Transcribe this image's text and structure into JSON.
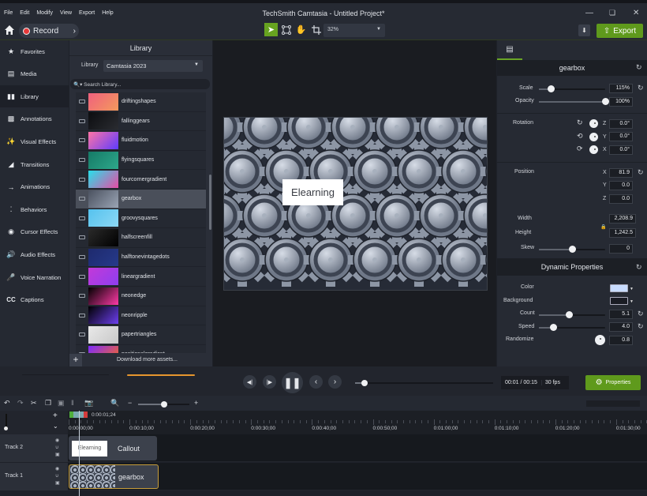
{
  "window": {
    "title": "TechSmith Camtasia - Untitled Project*",
    "menu": [
      "File",
      "Edit",
      "Modify",
      "View",
      "Export",
      "Help"
    ]
  },
  "toolbar": {
    "record_label": "Record",
    "zoom_value": "32%",
    "export_label": "Export",
    "accent_color": "#67a320"
  },
  "nav": {
    "items": [
      {
        "label": "Favorites",
        "icon": "star-icon"
      },
      {
        "label": "Media",
        "icon": "film-icon"
      },
      {
        "label": "Library",
        "icon": "library-icon",
        "active": true
      },
      {
        "label": "Annotations",
        "icon": "annotation-icon"
      },
      {
        "label": "Visual Effects",
        "icon": "wand-icon"
      },
      {
        "label": "Transitions",
        "icon": "transition-icon"
      },
      {
        "label": "Animations",
        "icon": "animation-icon"
      },
      {
        "label": "Behaviors",
        "icon": "behaviors-icon"
      },
      {
        "label": "Cursor Effects",
        "icon": "cursor-icon"
      },
      {
        "label": "Audio Effects",
        "icon": "speaker-icon"
      },
      {
        "label": "Voice Narration",
        "icon": "microphone-icon"
      },
      {
        "label": "Captions",
        "icon": "cc-icon"
      }
    ]
  },
  "library": {
    "title": "Library",
    "selector_label": "Library",
    "selector_value": "Camtasia 2023",
    "search_placeholder": "Search Library...",
    "items": [
      {
        "name": "driftingshapes",
        "colors": [
          "#f0607e",
          "#f49a5c"
        ]
      },
      {
        "name": "fallinggears",
        "colors": [
          "#0c0d10",
          "#2a2c31"
        ]
      },
      {
        "name": "fluidmotion",
        "colors": [
          "#ff74a6",
          "#5e3bff"
        ]
      },
      {
        "name": "flyingsquares",
        "colors": [
          "#157a66",
          "#2ea88b"
        ]
      },
      {
        "name": "fourcornergradient",
        "colors": [
          "#27e0ea",
          "#e84ca5"
        ]
      },
      {
        "name": "gearbox",
        "colors": [
          "#4b5260",
          "#9aa4b4"
        ],
        "selected": true
      },
      {
        "name": "groovysquares",
        "colors": [
          "#55c2ee",
          "#8dd8f5"
        ]
      },
      {
        "name": "halfscreenfill",
        "colors": [
          "#2a2a2a",
          "#000000"
        ]
      },
      {
        "name": "halftonevintagedots",
        "colors": [
          "#1e2a6e",
          "#263a8a"
        ]
      },
      {
        "name": "lineargradient",
        "colors": [
          "#c339d8",
          "#8d3ff0"
        ]
      },
      {
        "name": "neonedge",
        "colors": [
          "#000000",
          "#ff3aa6"
        ]
      },
      {
        "name": "neonripple",
        "colors": [
          "#000000",
          "#6d3ff0"
        ]
      },
      {
        "name": "papertriangles",
        "colors": [
          "#e9e9e9",
          "#c8c8c8"
        ]
      },
      {
        "name": "positionalgradient",
        "colors": [
          "#7d2bff",
          "#ff6a1a"
        ]
      }
    ],
    "download_label": "Download more assets..."
  },
  "canvas": {
    "callout_text": "Elearning"
  },
  "properties": {
    "title": "gearbox",
    "scale": {
      "label": "Scale",
      "value": "115%",
      "fraction": 0.18
    },
    "opacity": {
      "label": "Opacity",
      "value": "100%",
      "fraction": 1.0
    },
    "rotation": {
      "label": "Rotation",
      "z": "0.0°",
      "y": "0.0°",
      "x": "0.0°"
    },
    "position": {
      "label": "Position",
      "x": "81.9",
      "y": "0.0",
      "z": "0.0"
    },
    "width": {
      "label": "Width",
      "value": "2,208.9"
    },
    "height": {
      "label": "Height",
      "value": "1,242.5"
    },
    "skew": {
      "label": "Skew",
      "value": "0",
      "fraction": 0.5
    },
    "axis_labels": {
      "x": "X",
      "y": "Y",
      "z": "Z"
    },
    "dynamic": {
      "title": "Dynamic Properties",
      "color": {
        "label": "Color",
        "value": "#c8dcff"
      },
      "background": {
        "label": "Background",
        "value": "#1a1c24"
      },
      "count": {
        "label": "Count",
        "value": "5.1",
        "fraction": 0.45
      },
      "speed": {
        "label": "Speed",
        "value": "4.0",
        "fraction": 0.22
      },
      "randomize": {
        "label": "Randomize",
        "value": "0.8"
      }
    }
  },
  "playback": {
    "time": "00:01 / 00:15",
    "fps": "30 fps",
    "properties_label": "Properties",
    "progress_fraction": 0.07
  },
  "timeline": {
    "playhead_time": "0:00:01;24",
    "ruler": [
      "0:00:00;00",
      "0:00:10;00",
      "0:00:20;00",
      "0:00:30;00",
      "0:00:40;00",
      "0:00:50;00",
      "0:01:00;00",
      "0:01:10;00",
      "0:01:20;00",
      "0:01:30;00"
    ],
    "tracks": [
      {
        "label": "Track 2",
        "clip_title": "Callout",
        "clip_thumb_text": "Elearning"
      },
      {
        "label": "Track 1",
        "clip_title": "gearbox"
      }
    ]
  }
}
